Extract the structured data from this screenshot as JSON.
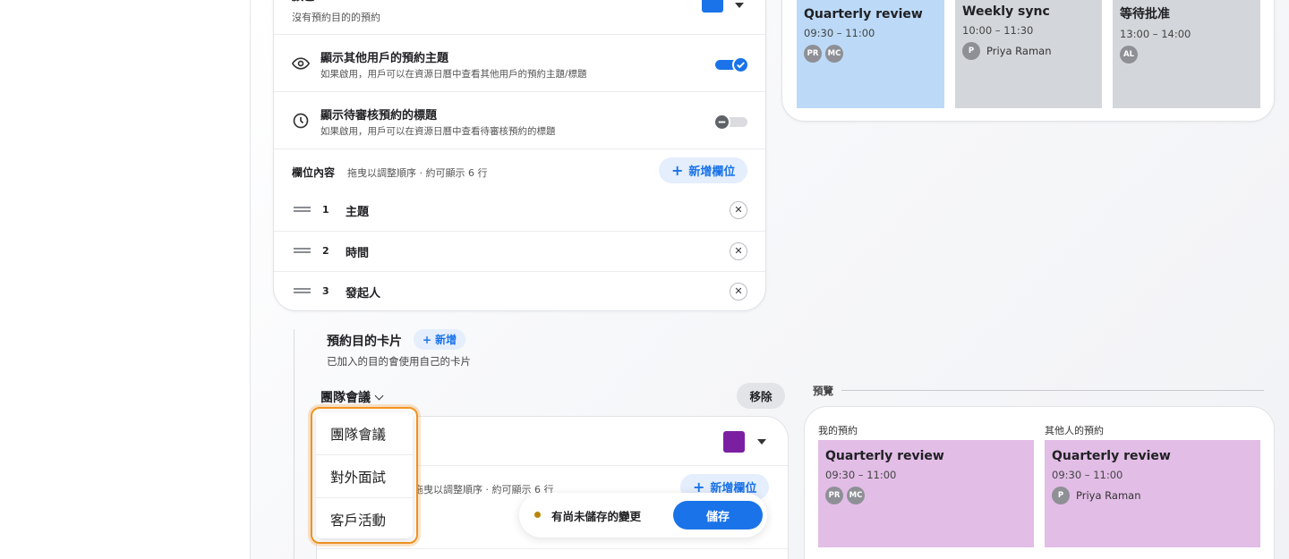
{
  "settings": {
    "color": {
      "title": "顏色",
      "sub": "沒有預約目的的預約",
      "swatch": "#1a73e8"
    },
    "show_other_topics": {
      "title": "顯示其他用戶的預約主題",
      "sub": "如果啟用，用戶可以在資源日曆中查看其他用戶的預約主題/標題",
      "on": true
    },
    "show_pending_titles": {
      "title": "顯示待審核預約的標題",
      "sub": "如果啟用，用戶可以在資源日曆中查看待審核預約的標題",
      "on": false
    },
    "fields": {
      "heading": "欄位內容",
      "hint": "拖曳以調整順序 · 約可顯示 6 行",
      "add_label": "新增欄位",
      "items": [
        {
          "num": "1",
          "name": "主題"
        },
        {
          "num": "2",
          "name": "時間"
        },
        {
          "num": "3",
          "name": "發起人"
        }
      ]
    }
  },
  "preview_top": {
    "events": [
      {
        "title": "Quarterly review",
        "time": "09:30 – 11:00",
        "avatars": [
          "PR",
          "MC"
        ],
        "person": "",
        "color": "#bcdaf7"
      },
      {
        "title": "Weekly sync",
        "time": "10:00 – 11:30",
        "avatars": [
          "P"
        ],
        "person": "Priya Raman",
        "color": "#d3d6da"
      },
      {
        "title": "等待批准",
        "time": "13:00 – 14:00",
        "avatars": [
          "AL"
        ],
        "person": "",
        "color": "#d3d6da"
      }
    ]
  },
  "purpose_cards": {
    "title": "預約目的卡片",
    "add_label": "新增",
    "sub": "已加入的目的會使用自己的卡片",
    "selected": "團隊會議",
    "remove_label": "移除",
    "swatch": "#7b1fa2",
    "hint": "拖曳以調整順序 · 約可顯示 6 行",
    "add_field_label": "新增欄位",
    "options": [
      "團隊會議",
      "對外面試",
      "客戶活動"
    ]
  },
  "savebar": {
    "message": "有尚未儲存的變更",
    "save_label": "儲存"
  },
  "preview": {
    "label": "預覽",
    "mine_label": "我的預約",
    "others_label": "其他人的預約",
    "mine": {
      "title": "Quarterly review",
      "time": "09:30 – 11:00",
      "avatars": [
        "PR",
        "MC"
      ]
    },
    "others": {
      "title": "Quarterly review",
      "time": "09:30 – 11:00",
      "avatar": "P",
      "person": "Priya Raman"
    },
    "color": "#e2bde6"
  }
}
